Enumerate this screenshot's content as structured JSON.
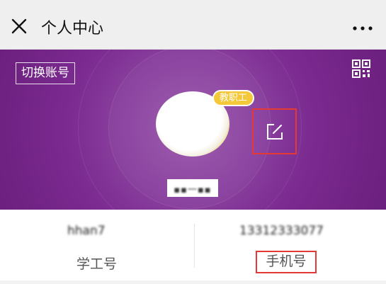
{
  "topbar": {
    "title": "个人中心",
    "close_icon": "close-icon",
    "more_icon": "more-icon"
  },
  "header": {
    "switch_account_label": "切换账号",
    "qr_icon": "qr-code-icon",
    "role_badge": "教职工",
    "edit_icon": "edit-icon",
    "name": "▪▪一▪▪",
    "colors": {
      "purple": "#7b2a8f",
      "badge": "#f4c838",
      "highlight": "#e53935"
    }
  },
  "info": {
    "staff_id_value": "hhan7",
    "staff_id_label": "学工号",
    "phone_value": "13312333077",
    "phone_label": "手机号"
  }
}
